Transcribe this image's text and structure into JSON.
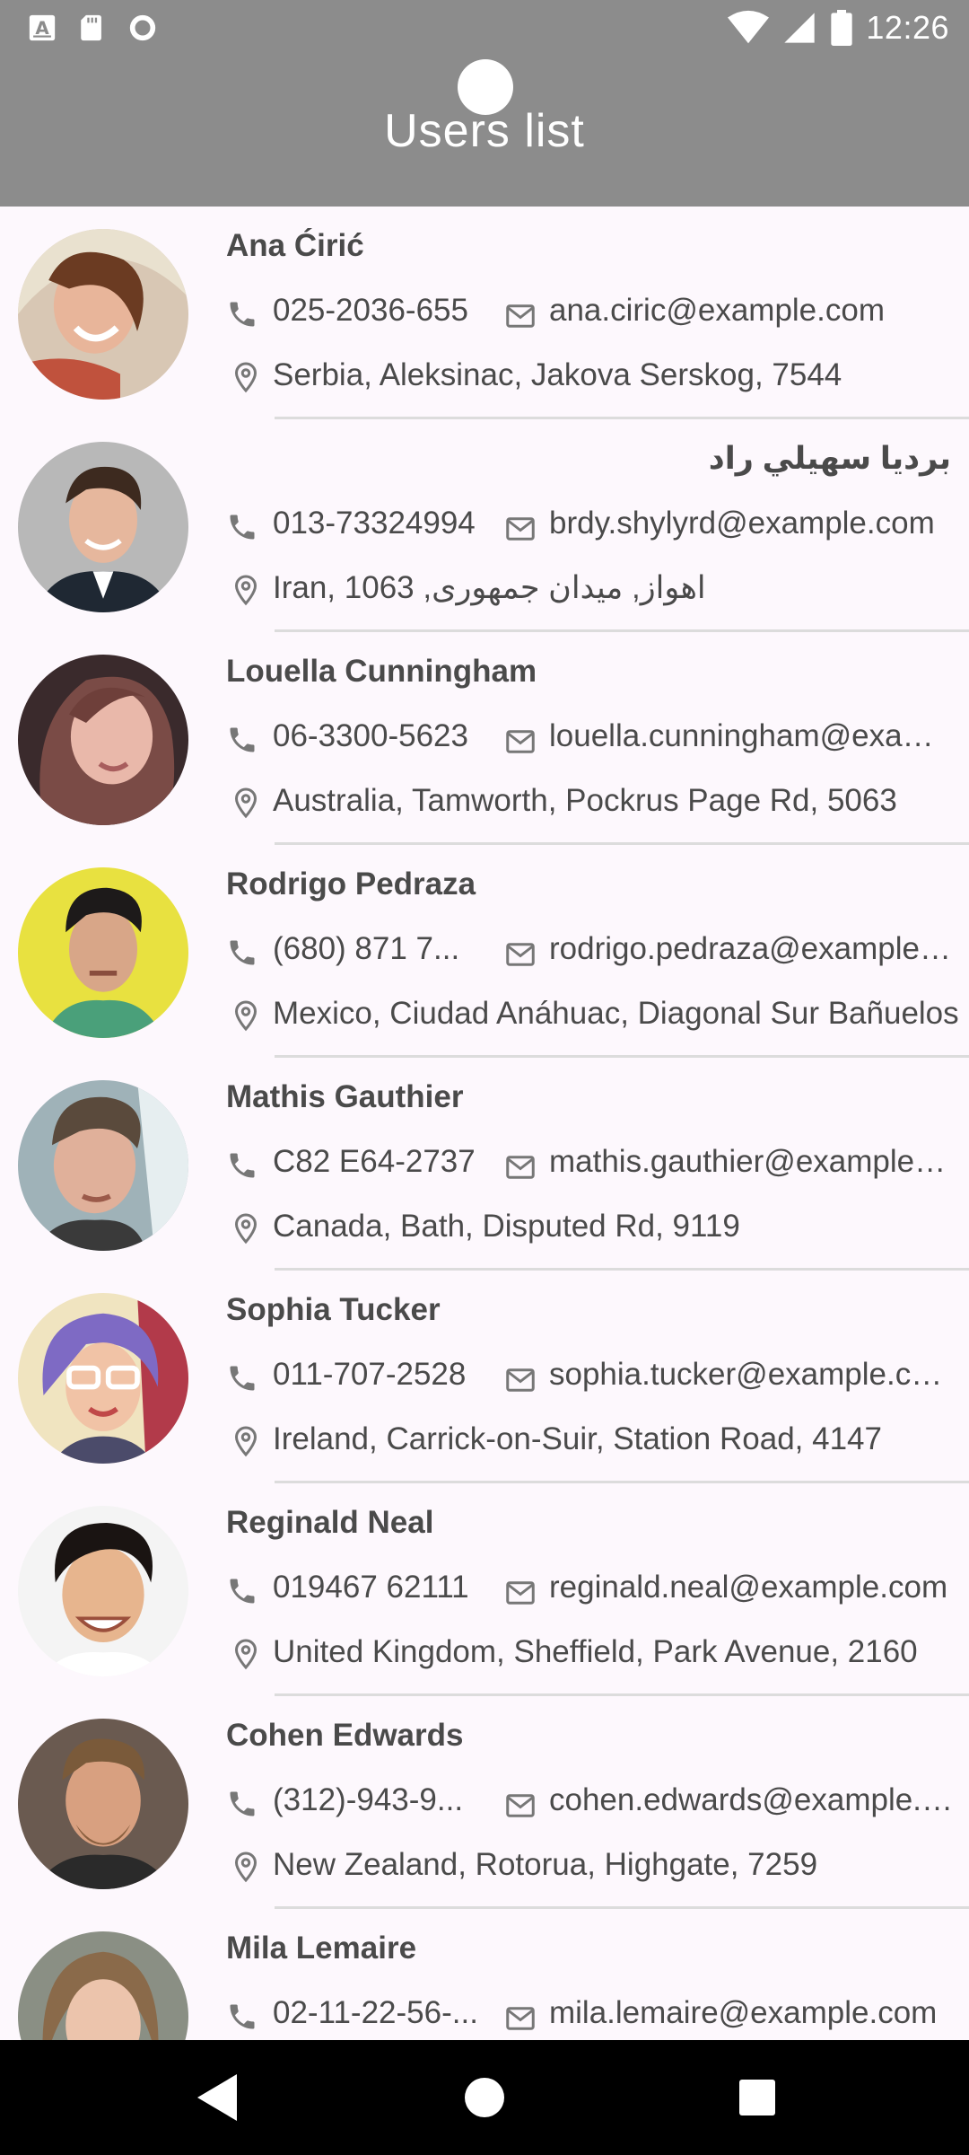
{
  "status_bar": {
    "time": "12:26",
    "left_icons": [
      "a-badge-icon",
      "sd-card-icon",
      "sync-circle-icon"
    ],
    "right_icons": [
      "wifi-icon",
      "cell-signal-icon",
      "battery-icon"
    ]
  },
  "app_bar": {
    "title": "Users list"
  },
  "users": [
    {
      "name": "Ana Ćirić",
      "phone": "025-2036-655",
      "email": "ana.ciric@example.com",
      "address": "Serbia, Aleksinac, Jakova Serskog, 7544"
    },
    {
      "name": "برديا سهيلي راد",
      "phone": "013-73324994",
      "email": "brdy.shylyrd@example.com",
      "address": "Iran, 1063 ,اهواز, میدان جمهوری"
    },
    {
      "name": "Louella Cunningham",
      "phone": "06-3300-5623",
      "email": "louella.cunningham@example.com",
      "address": "Australia, Tamworth, Pockrus Page Rd, 5063"
    },
    {
      "name": "Rodrigo Pedraza",
      "phone": "(680) 871 7...",
      "email": "rodrigo.pedraza@example.com",
      "address": "Mexico, Ciudad Anáhuac, Diagonal Sur Bañuelos"
    },
    {
      "name": "Mathis Gauthier",
      "phone": "C82 E64-2737",
      "email": "mathis.gauthier@example.com",
      "address": "Canada, Bath, Disputed Rd, 9119"
    },
    {
      "name": "Sophia Tucker",
      "phone": "011-707-2528",
      "email": "sophia.tucker@example.com",
      "address": "Ireland, Carrick-on-Suir, Station Road, 4147"
    },
    {
      "name": "Reginald Neal",
      "phone": "019467 62111",
      "email": "reginald.neal@example.com",
      "address": "United Kingdom, Sheffield, Park Avenue, 2160"
    },
    {
      "name": "Cohen Edwards",
      "phone": "(312)-943-9...",
      "email": "cohen.edwards@example.com",
      "address": "New Zealand, Rotorua, Highgate, 7259"
    },
    {
      "name": "Mila Lemaire",
      "phone": "02-11-22-56-...",
      "email": "mila.lemaire@example.com",
      "address": ""
    }
  ],
  "nav_bar": {
    "buttons": [
      "back-icon",
      "home-icon",
      "recents-icon"
    ]
  }
}
